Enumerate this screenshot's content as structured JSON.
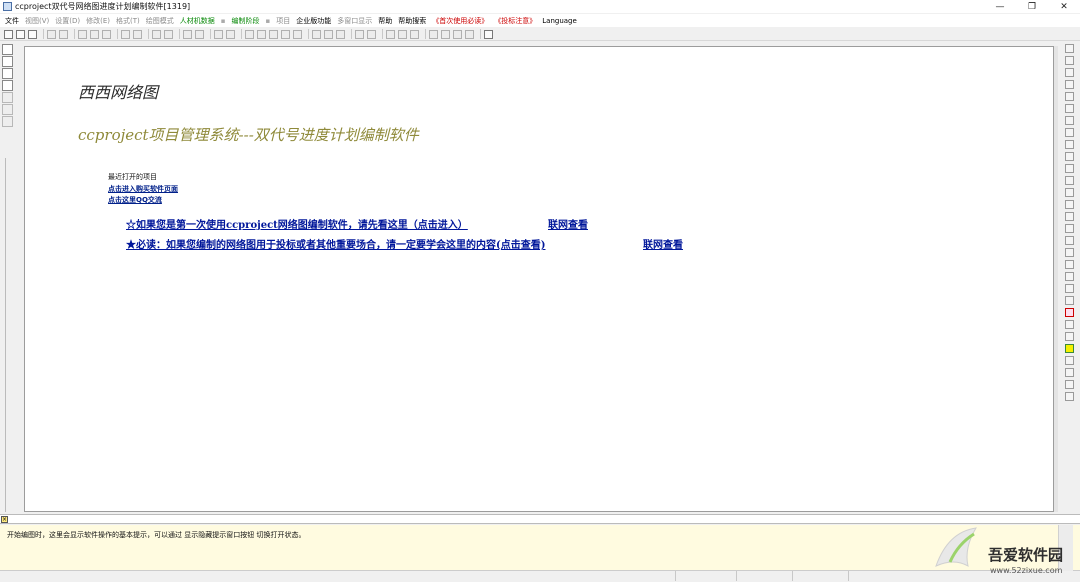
{
  "window": {
    "title": "ccproject双代号网络图进度计划编制软件[1319]",
    "minimize_glyph": "—",
    "maximize_glyph": "❐",
    "close_glyph": "✕"
  },
  "menu": [
    {
      "label": "文件",
      "style": "normal"
    },
    {
      "label": "视图(V)",
      "style": "disabled"
    },
    {
      "label": "设置(D)",
      "style": "disabled"
    },
    {
      "label": "修改(E)",
      "style": "disabled"
    },
    {
      "label": "格式(T)",
      "style": "disabled"
    },
    {
      "label": "绘图模式",
      "style": "disabled"
    },
    {
      "label": "人材机数据",
      "style": "green"
    },
    {
      "label": "编制阶段",
      "style": "green"
    },
    {
      "label": "项目",
      "style": "disabled"
    },
    {
      "label": "企业版功能",
      "style": "normal"
    },
    {
      "label": "多窗口显示",
      "style": "disabled"
    },
    {
      "label": "帮助",
      "style": "normal"
    },
    {
      "label": "帮助搜索",
      "style": "normal"
    },
    {
      "label": "《首次使用必读》",
      "style": "red"
    },
    {
      "label": "《投标注意》",
      "style": "red"
    },
    {
      "label": "Language",
      "style": "normal"
    }
  ],
  "start_page": {
    "title": "西西网络图",
    "subtitle": "ccproject项目管理系统---双代号进度计划编制软件",
    "recent_label": "最近打开的项目",
    "buy_link": "点击进入购买软件页面",
    "qq_link": "点击这里QQ交流",
    "first_use_link": "☆如果您是第一次使用ccproject网络图编制软件，请先看这里（点击进入）",
    "first_use_online": "联网查看",
    "must_read_link": "★必读：如果您编制的网络图用于投标或者其他重要场合，请一定要学会这里的内容(点击查看)",
    "must_read_online": "联网查看"
  },
  "hint_panel": {
    "text": "开始编图时，这里会显示软件操作的基本提示，可以通过 显示隐藏提示窗口按钮 切换打开状态。"
  },
  "watermark": {
    "brand": "吾爱软件园",
    "url": "www.52zixue.com"
  },
  "icons": {
    "app": "app-icon",
    "close_panel": "close-panel-icon"
  }
}
